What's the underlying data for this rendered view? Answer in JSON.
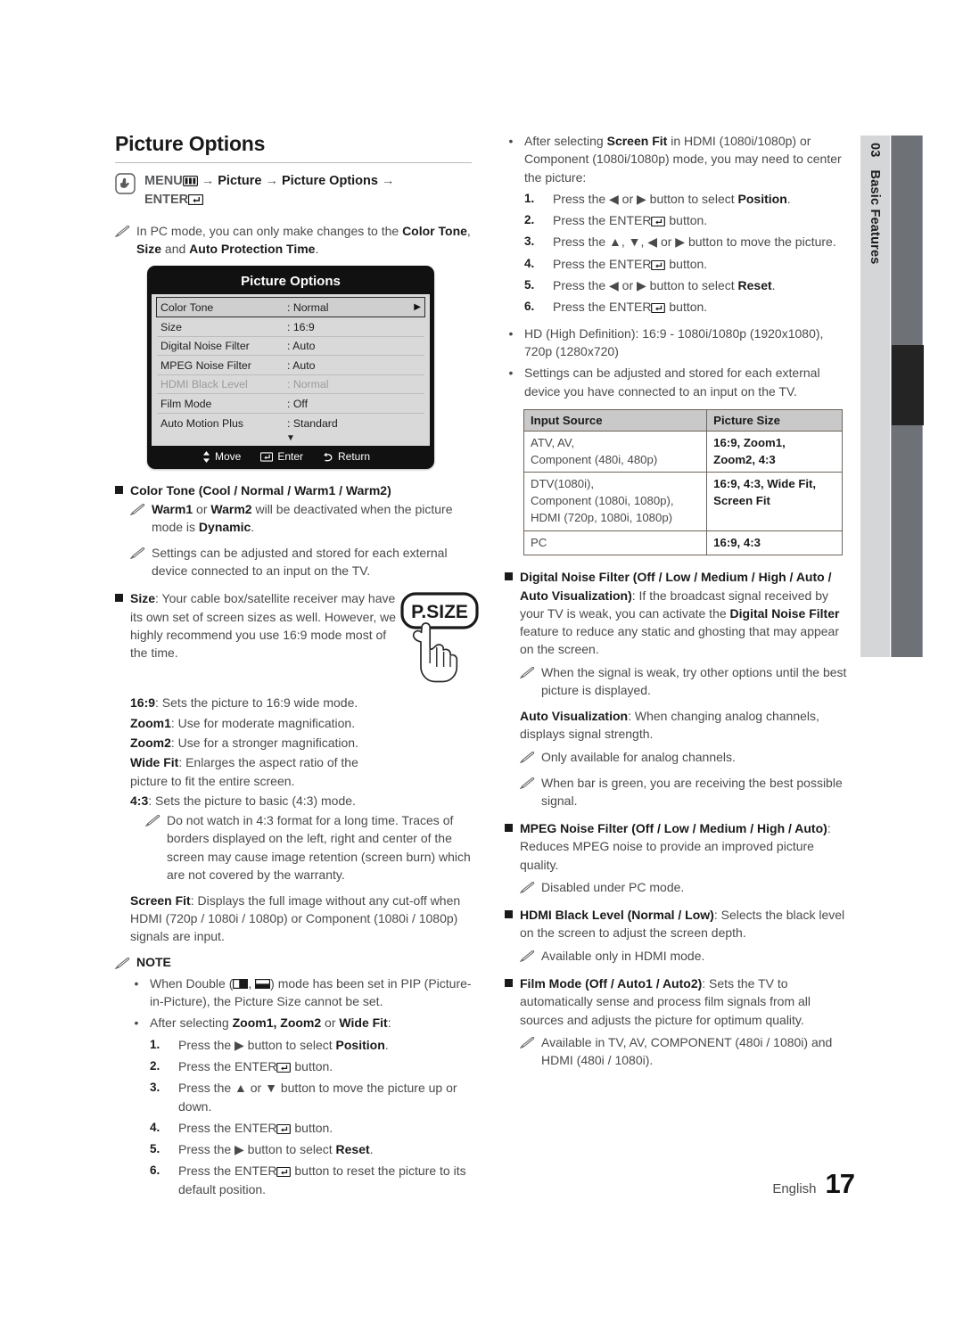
{
  "page": {
    "title": "Picture Options",
    "footer_language": "English",
    "footer_page": "17",
    "side_tab_number": "03",
    "side_tab_label": "Basic Features"
  },
  "menu_path": {
    "prefix": "MENU",
    "menu_icon": "menu-grid-icon",
    "step1": "Picture",
    "step2": "Picture Options",
    "enter_label": "ENTER",
    "enter_icon": "enter-return-icon",
    "arrow": "→"
  },
  "pc_mode_note": {
    "text_before": "In PC mode, you can only make changes to the ",
    "b1": "Color Tone",
    "sep1": ", ",
    "b2": "Size",
    "sep2": " and ",
    "b3": "Auto Protection Time",
    "text_after": "."
  },
  "tv_menu": {
    "title": "Picture Options",
    "rows": [
      {
        "label": "Color Tone",
        "value": ": Normal",
        "selected": true,
        "dimmed": false,
        "arrow": "▶"
      },
      {
        "label": "Size",
        "value": ": 16:9",
        "selected": false,
        "dimmed": false,
        "arrow": ""
      },
      {
        "label": "Digital Noise Filter",
        "value": ": Auto",
        "selected": false,
        "dimmed": false,
        "arrow": ""
      },
      {
        "label": "MPEG Noise Filter",
        "value": ": Auto",
        "selected": false,
        "dimmed": false,
        "arrow": ""
      },
      {
        "label": "HDMI Black Level",
        "value": ": Normal",
        "selected": false,
        "dimmed": true,
        "arrow": ""
      },
      {
        "label": "Film Mode",
        "value": ": Off",
        "selected": false,
        "dimmed": false,
        "arrow": ""
      },
      {
        "label": "Auto Motion Plus",
        "value": ": Standard",
        "selected": false,
        "dimmed": false,
        "arrow": ""
      }
    ],
    "scroll_down": "▼",
    "nav": {
      "move": "Move",
      "enter": "Enter",
      "return": "Return"
    }
  },
  "color_tone": {
    "heading_bold": "Color Tone",
    "heading_rest": " (Cool / Normal / Warm1 / Warm2)",
    "note1": {
      "b1": "Warm1",
      "t1": " or ",
      "b2": "Warm2",
      "t2": " will be deactivated when the picture mode is ",
      "b3": "Dynamic",
      "t3": "."
    },
    "note2": "Settings can be adjusted and stored for each external device connected to an input on the TV."
  },
  "size": {
    "heading_bold": "Size",
    "heading_rest": ": Your cable box/satellite receiver may have its own set of screen sizes as well. However, we highly recommend you use 16:9 mode most of the time.",
    "remote_button_label": "P.SIZE",
    "options": [
      {
        "b": "16:9",
        "t": ": Sets the picture to 16:9 wide mode."
      },
      {
        "b": "Zoom1",
        "t": ": Use for moderate magnification."
      },
      {
        "b": "Zoom2",
        "t": ": Use for a stronger magnification."
      },
      {
        "b": "Wide Fit",
        "t": ": Enlarges the aspect ratio of the picture to fit the entire screen."
      },
      {
        "b": "4:3",
        "t": ": Sets the picture to basic (4:3) mode."
      }
    ],
    "warning_note": "Do not watch in 4:3 format for a long time. Traces of borders displayed on the left, right and center of the screen may cause image retention (screen burn) which are not covered by the warranty.",
    "screen_fit_bold": "Screen Fit",
    "screen_fit_rest": ": Displays the full image without any cut-off when HDMI (720p / 1080i / 1080p) or Component (1080i / 1080p) signals are input."
  },
  "note_section": {
    "heading": "NOTE",
    "bullets": [
      {
        "parts_before": "When Double (",
        "icon1": "pip-double-left-icon",
        "mid": ", ",
        "icon2": "pip-double-right-icon",
        "parts_after": ") mode has been set in PIP (Picture-in-Picture), the Picture Size cannot be set."
      }
    ],
    "after_selecting": {
      "t1": "After selecting ",
      "b1": "Zoom1, Zoom2",
      "t2": " or ",
      "b2": "Wide Fit",
      "t3": ":"
    },
    "steps": [
      {
        "n": "1.",
        "t1": "Press the ▶ button to select ",
        "b": "Position",
        "t2": "."
      },
      {
        "n": "2.",
        "t1": "Press the ENTER",
        "b": "",
        "t2": " button.",
        "enter": true
      },
      {
        "n": "3.",
        "t1": "Press the ▲ or ▼ button to move the picture up or down.",
        "b": "",
        "t2": ""
      },
      {
        "n": "4.",
        "t1": "Press the ENTER",
        "b": "",
        "t2": " button.",
        "enter": true
      },
      {
        "n": "5.",
        "t1": "Press the ▶ button to select ",
        "b": "Reset",
        "t2": "."
      },
      {
        "n": "6.",
        "t1": "Press the ENTER",
        "b": "",
        "t2": " button to reset the picture to its default position.",
        "enter": true
      }
    ]
  },
  "right_column": {
    "screen_fit_bullet": {
      "t1": "After selecting ",
      "b1": "Screen Fit",
      "t2": " in HDMI (1080i/1080p) or Component (1080i/1080p) mode, you may need to center the picture:"
    },
    "screen_fit_steps": [
      {
        "n": "1.",
        "t1": "Press the ◀ or ▶ button to select ",
        "b": "Position",
        "t2": "."
      },
      {
        "n": "2.",
        "t1": "Press the ENTER",
        "b": "",
        "t2": " button.",
        "enter": true
      },
      {
        "n": "3.",
        "t1": "Press the ▲, ▼, ◀ or ▶ button to move the picture.",
        "b": "",
        "t2": ""
      },
      {
        "n": "4.",
        "t1": "Press the ENTER",
        "b": "",
        "t2": " button.",
        "enter": true
      },
      {
        "n": "5.",
        "t1": "Press the ◀ or ▶ button to select ",
        "b": "Reset",
        "t2": "."
      },
      {
        "n": "6.",
        "t1": "Press the ENTER",
        "b": "",
        "t2": " button.",
        "enter": true
      }
    ],
    "hd_bullet": "HD (High Definition): 16:9 - 1080i/1080p (1920x1080), 720p (1280x720)",
    "settings_bullet": "Settings can be adjusted and stored for each external device you have connected to an input on the TV.",
    "table": {
      "headers": [
        "Input Source",
        "Picture Size"
      ],
      "rows": [
        {
          "source": [
            "ATV, AV,",
            "Component (480i, 480p)"
          ],
          "size": [
            "16:9, Zoom1,",
            "Zoom2, 4:3"
          ]
        },
        {
          "source": [
            "DTV(1080i),",
            "Component (1080i, 1080p),",
            "HDMI (720p, 1080i, 1080p)"
          ],
          "size": [
            "16:9, 4:3, Wide Fit,",
            "Screen Fit"
          ]
        },
        {
          "source": [
            "PC"
          ],
          "size": [
            "16:9, 4:3"
          ]
        }
      ]
    },
    "digital_noise_filter": {
      "b1": "Digital Noise Filter (Off / Low / Medium / High / Auto / Auto Visualization)",
      "t1": ": If the broadcast signal received by your TV is weak, you can activate the ",
      "b2": "Digital Noise Filter",
      "t2": " feature to reduce any static and ghosting that may appear on the screen.",
      "note": "When the signal is weak, try other options until the best picture is displayed.",
      "auto_vis_bold": "Auto Visualization",
      "auto_vis_rest": ": When changing analog channels, displays signal strength.",
      "note2": "Only available for analog channels.",
      "note3": "When bar is green, you are receiving the best possible signal."
    },
    "mpeg_noise_filter": {
      "b1": "MPEG Noise Filter (Off / Low / Medium / High / Auto)",
      "t1": ": Reduces MPEG noise to provide an improved picture quality.",
      "note": "Disabled under PC mode."
    },
    "hdmi_black_level": {
      "b1": "HDMI Black Level (Normal / Low)",
      "t1": ": Selects the black level on the screen to adjust the screen depth.",
      "note": "Available only in HDMI mode."
    },
    "film_mode": {
      "b1": "Film Mode (Off / Auto1 / Auto2)",
      "t1": ": Sets the TV to automatically sense and process film signals from all sources and adjusts the picture for optimum quality.",
      "note": "Available in TV, AV, COMPONENT (480i / 1080i) and HDMI (480i / 1080i)."
    }
  }
}
